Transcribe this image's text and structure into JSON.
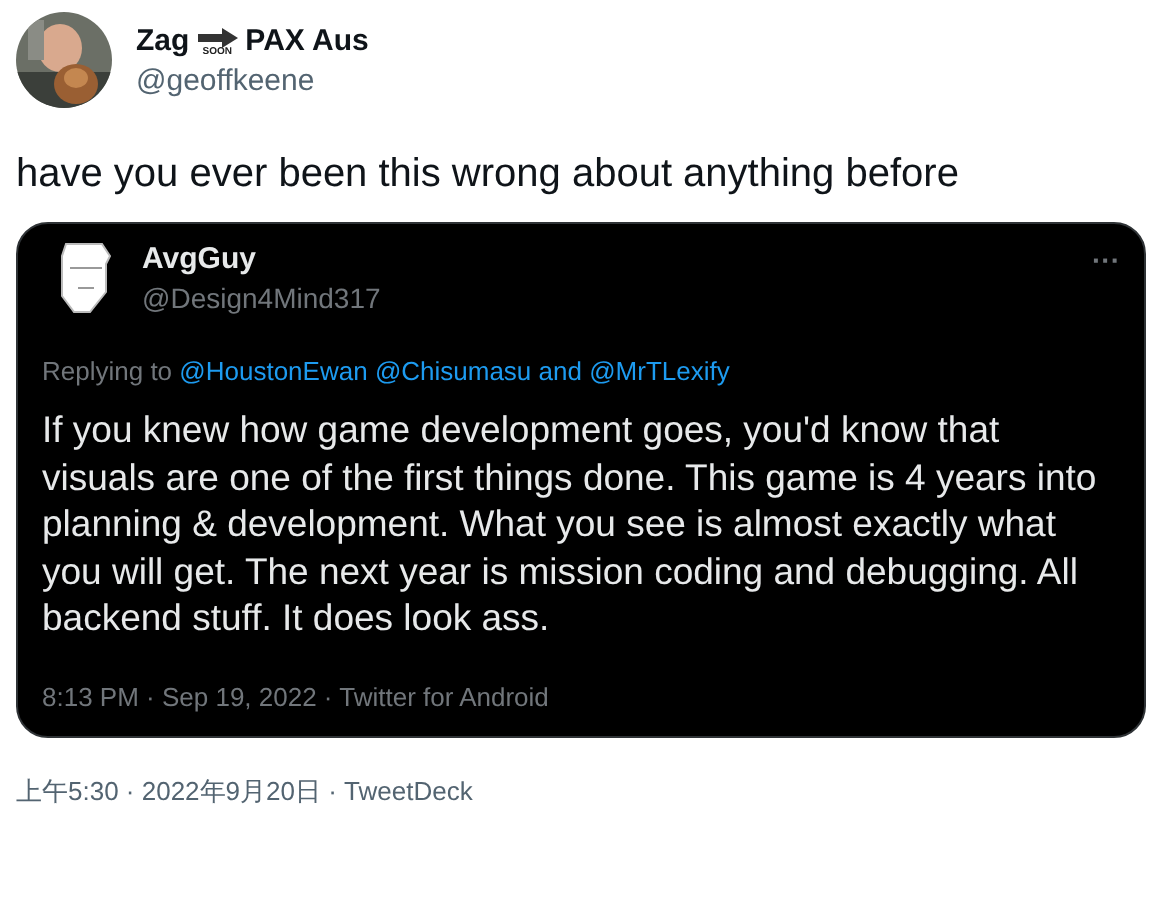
{
  "author": {
    "name_start": "Zag",
    "emoji_label": "SOON",
    "name_end": "PAX Aus",
    "handle": "@geoffkeene"
  },
  "text": "have you ever been this wrong about anything before",
  "quote": {
    "name": "AvgGuy",
    "handle": "@Design4Mind317",
    "more": "···",
    "replying": {
      "prefix": "Replying to",
      "mentions": [
        "@HoustonEwan",
        "@Chisumasu",
        "@MrTLexify"
      ],
      "conjunction": "and"
    },
    "text": "If you knew how game development goes, you'd know that visuals are one of the first things done. This game is 4 years into planning & development. What you see is almost exactly what you will get. The next year is mission coding and debugging. All backend stuff. It does look ass.",
    "meta": "8:13 PM · Sep 19, 2022 · Twitter for Android"
  },
  "meta": "上午5:30 · 2022年9月20日 · TweetDeck"
}
